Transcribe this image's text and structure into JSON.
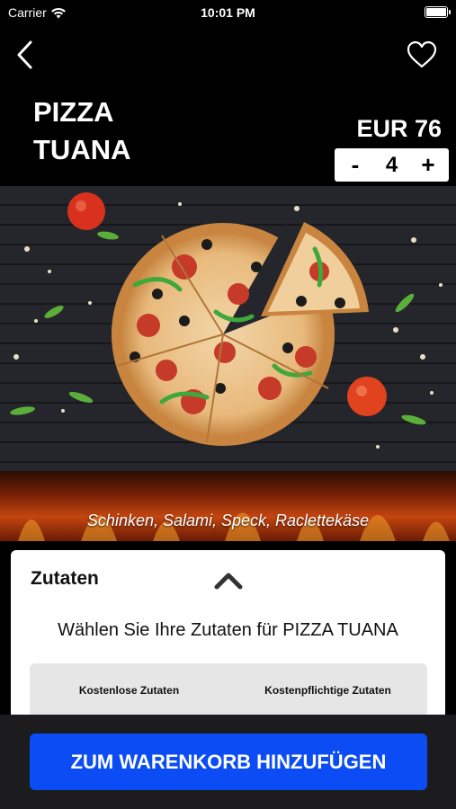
{
  "status_bar": {
    "carrier": "Carrier",
    "time": "10:01 PM"
  },
  "product": {
    "name_line1": "PIZZA",
    "name_line2": "TUANA",
    "price": "EUR 76",
    "quantity": "4",
    "decrement_label": "-",
    "increment_label": "+",
    "description": "Schinken, Salami, Speck, Raclettekäse"
  },
  "ingredients": {
    "title": "Zutaten",
    "subtitle": "Wählen Sie Ihre Zutaten für PIZZA TUANA",
    "tabs": [
      {
        "label": "Kostenlose Zutaten"
      },
      {
        "label": "Kostenpflichtige Zutaten"
      }
    ]
  },
  "footer": {
    "add_to_cart_label": "ZUM WARENKORB HINZUFÜGEN"
  },
  "colors": {
    "accent": "#0b4cf5",
    "background": "#000000",
    "footer": "#1c1c1e"
  },
  "icons": [
    "wifi-icon",
    "battery-icon",
    "back-chevron-icon",
    "heart-icon",
    "chevron-up-icon"
  ]
}
